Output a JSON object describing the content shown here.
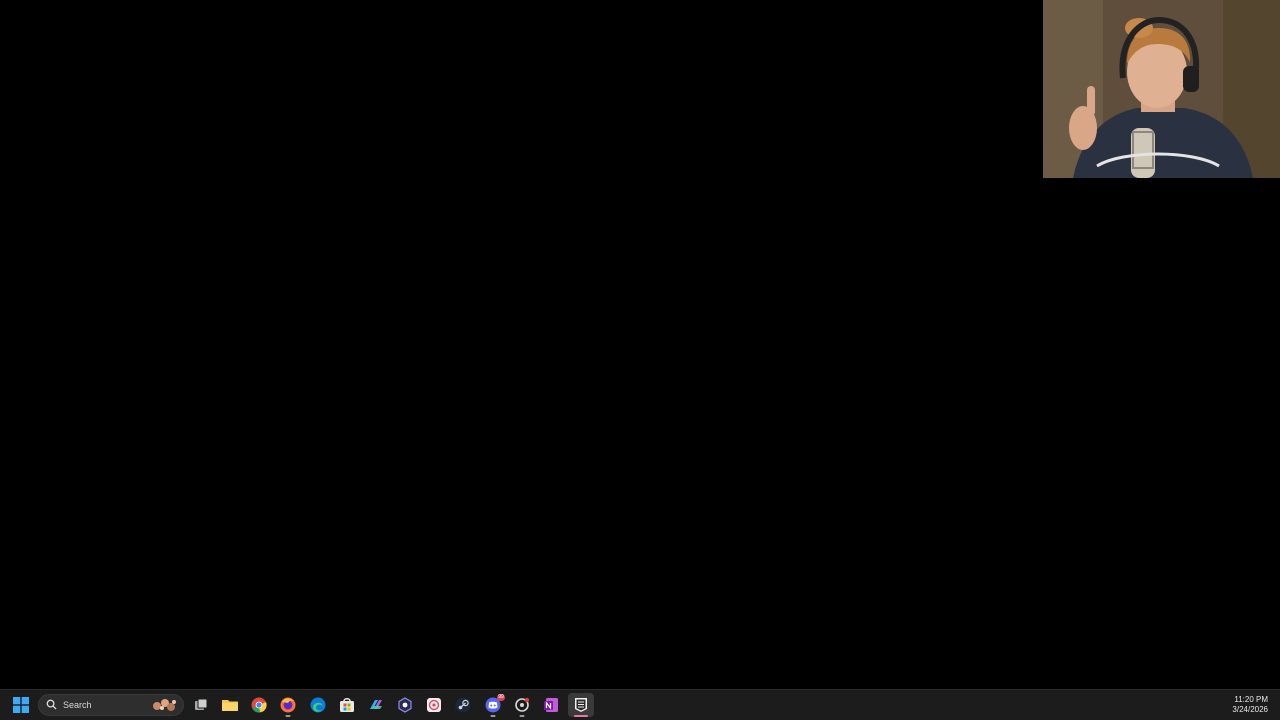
{
  "taskbar": {
    "search_placeholder": "Search",
    "clock": {
      "time": "11:20 PM",
      "date": "3/24/2026"
    },
    "apps": [
      {
        "name": "task-view",
        "icon": "task-view-icon"
      },
      {
        "name": "file-explorer",
        "icon": "folder-icon"
      },
      {
        "name": "chrome",
        "icon": "chrome-icon"
      },
      {
        "name": "firefox",
        "icon": "firefox-icon"
      },
      {
        "name": "edge",
        "icon": "edge-icon"
      },
      {
        "name": "microsoft-store",
        "icon": "store-icon"
      },
      {
        "name": "copilot",
        "icon": "copilot-icon"
      },
      {
        "name": "app",
        "icon": "hexagon-app-icon"
      },
      {
        "name": "app",
        "icon": "pattern-app-icon"
      },
      {
        "name": "steam",
        "icon": "steam-icon"
      },
      {
        "name": "discord",
        "icon": "discord-icon",
        "badge": "99"
      },
      {
        "name": "app",
        "icon": "ring-app-icon"
      },
      {
        "name": "onenote",
        "icon": "onenote-icon"
      },
      {
        "name": "epic-games",
        "icon": "epic-games-icon",
        "active": true
      }
    ]
  },
  "colors": {
    "desktop": "#000000",
    "taskbar": "#1c1c1c",
    "accent": "#e07aa0"
  }
}
